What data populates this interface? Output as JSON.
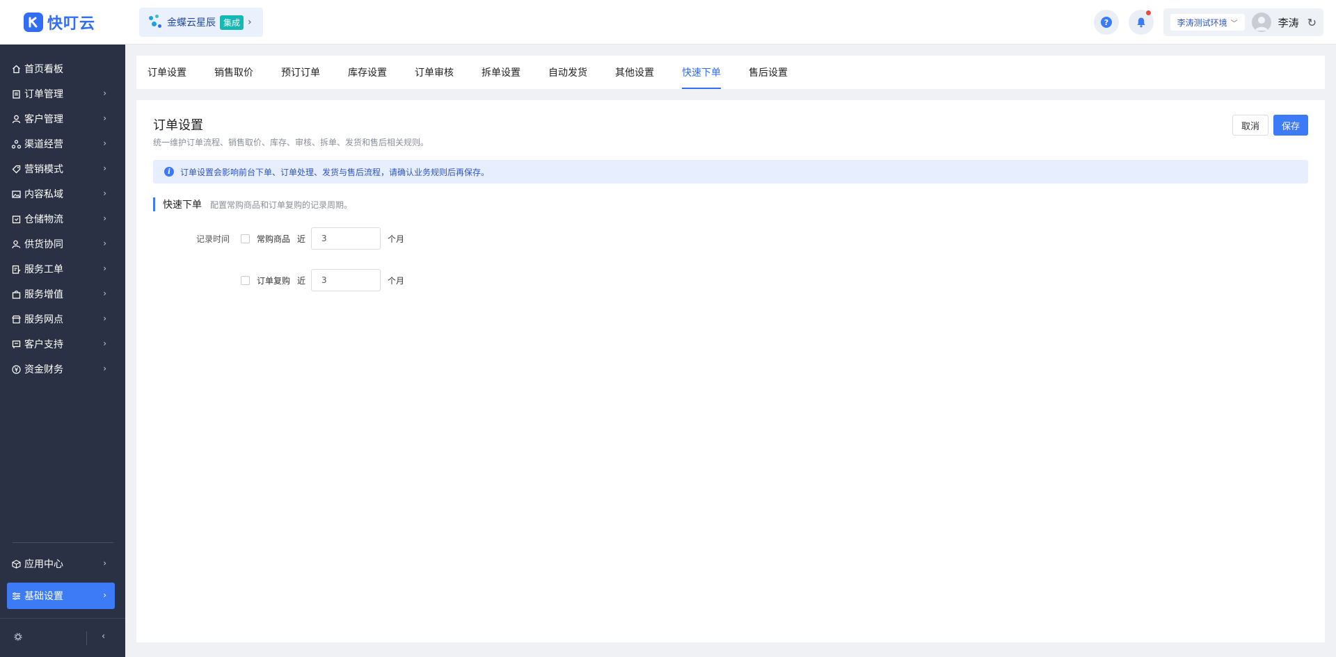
{
  "brand": {
    "name": "快叮云"
  },
  "app_switch": {
    "name": "金蝶云星辰",
    "badge": "集成"
  },
  "header": {
    "env": "李涛测试环境",
    "user": "李涛"
  },
  "sidebar": {
    "items": [
      {
        "label": "首页看板"
      },
      {
        "label": "订单管理"
      },
      {
        "label": "客户管理"
      },
      {
        "label": "渠道经营"
      },
      {
        "label": "营销模式"
      },
      {
        "label": "内容私域"
      },
      {
        "label": "仓储物流"
      },
      {
        "label": "供货协同"
      },
      {
        "label": "服务工单"
      },
      {
        "label": "服务增值"
      },
      {
        "label": "服务网点"
      },
      {
        "label": "客户支持"
      },
      {
        "label": "资金财务"
      }
    ],
    "bottom_items": [
      {
        "label": "应用中心"
      },
      {
        "label": "基础设置"
      }
    ]
  },
  "tabs": [
    {
      "label": "订单设置"
    },
    {
      "label": "销售取价"
    },
    {
      "label": "预订订单"
    },
    {
      "label": "库存设置"
    },
    {
      "label": "订单审核"
    },
    {
      "label": "拆单设置"
    },
    {
      "label": "自动发货"
    },
    {
      "label": "其他设置"
    },
    {
      "label": "快速下单",
      "active": true
    },
    {
      "label": "售后设置"
    }
  ],
  "panel": {
    "title": "订单设置",
    "subtitle": "统一维护订单流程、销售取价、库存、审核、拆单、发货和售后相关规则。",
    "cancel_label": "取消",
    "save_label": "保存",
    "notice": "订单设置会影响前台下单、订单处理、发货与售后流程，请确认业务规则后再保存。",
    "section": {
      "title": "快速下单",
      "desc": "配置常购商品和订单复购的记录周期。",
      "field_label": "记录时间",
      "rows": [
        {
          "option": "常购商品",
          "near": "近",
          "value": "3",
          "unit": "个月",
          "checked": false
        },
        {
          "option": "订单复购",
          "near": "近",
          "value": "3",
          "unit": "个月",
          "checked": false
        }
      ]
    }
  },
  "colors": {
    "primary": "#3d7bf6",
    "sidebar_bg": "#2b3145",
    "badge": "#15b8b3"
  }
}
